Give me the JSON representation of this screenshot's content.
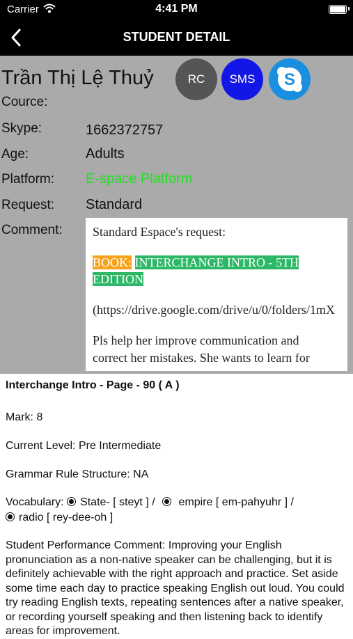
{
  "status": {
    "carrier": "Carrier",
    "time": "4:41 PM"
  },
  "nav": {
    "title": "STUDENT DETAIL"
  },
  "student": {
    "name": "Trần Thị Lệ Thuỷ",
    "labels": {
      "cource": "Cource:",
      "skype": "Skype:",
      "age": "Age:",
      "platform": "Platform:",
      "request": "Request:",
      "comment": "Comment:"
    },
    "skype": "1662372757",
    "age": "Adults",
    "platform": "E-space Platform",
    "request": "Standard"
  },
  "actions": {
    "rc": "RC",
    "sms": "SMS"
  },
  "comment": {
    "line1": "Standard Espace's request:",
    "book_label": "BOOK:",
    "book_title_1": "INTERCHANGE INTRO - 5TH",
    "book_title_2": "EDITION",
    "link": "(https://drive.google.com/drive/u/0/folders/1mX",
    "note_1": "Pls help her improve communication and",
    "note_2": "correct her mistakes. She wants to learn for"
  },
  "details": {
    "title": "Interchange Intro   - Page - 90 ( A )",
    "mark": "Mark: 8",
    "current_level": "Current Level: Pre Intermediate",
    "grammar": "Grammar Rule Structure: NA",
    "vocab_label": "Vocabulary:",
    "vocab_1": "State-  [ steyt ]  /",
    "vocab_2": "  empire [ em-pahyuhr ]  /",
    "vocab_3": "radio [ rey-dee-oh ]",
    "performance": "Student Performance Comment: Improving your English pronunciation as a non-native speaker can be challenging, but it is definitely achievable with the right approach and practice. Set aside some time each day to practice speaking English out loud. You could try reading English texts, repeating sentences after a native speaker, or recording yourself speaking and then listening back to identify areas for improvement."
  },
  "colors": {
    "nav_bg": "#000000",
    "panel_bg": "#aaaaaa",
    "sms": "#1216e6",
    "skype": "#1a8fe0",
    "rc": "#555555",
    "platform_text": "#22e022",
    "book_label_bg": "#f7a21b",
    "book_title_bg": "#2cb866"
  },
  "icons": {
    "back": "chevron-left-icon",
    "skype": "skype-icon",
    "wifi": "wifi-icon",
    "battery": "battery-icon"
  }
}
